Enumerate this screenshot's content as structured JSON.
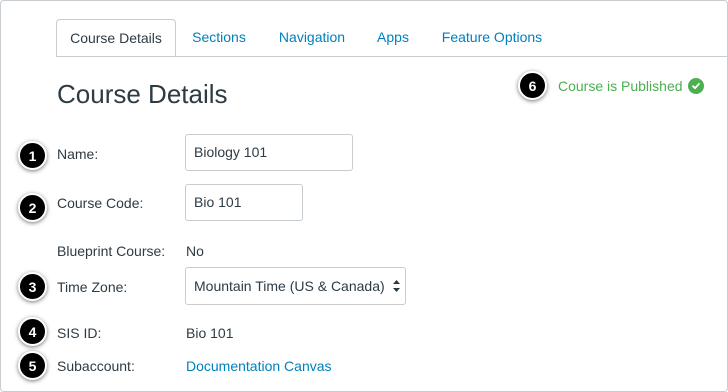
{
  "tabs": [
    {
      "label": "Course Details",
      "active": true
    },
    {
      "label": "Sections"
    },
    {
      "label": "Navigation"
    },
    {
      "label": "Apps"
    },
    {
      "label": "Feature Options"
    }
  ],
  "page_title": "Course Details",
  "status": {
    "text": "Course is Published",
    "icon": "check-circle-icon",
    "color": "#4caf50"
  },
  "markers": [
    "1",
    "2",
    "3",
    "4",
    "5",
    "6"
  ],
  "fields": {
    "name": {
      "label": "Name:",
      "value": "Biology 101"
    },
    "course_code": {
      "label": "Course Code:",
      "value": "Bio 101"
    },
    "blueprint": {
      "label": "Blueprint Course:",
      "value": "No"
    },
    "time_zone": {
      "label": "Time Zone:",
      "value": "Mountain Time (US & Canada) (-"
    },
    "sis_id": {
      "label": "SIS ID:",
      "value": "Bio 101"
    },
    "subaccount": {
      "label": "Subaccount:",
      "value": "Documentation Canvas"
    }
  },
  "colors": {
    "link": "#0081be",
    "text": "#2d3b45",
    "border": "#c7cdd1"
  }
}
